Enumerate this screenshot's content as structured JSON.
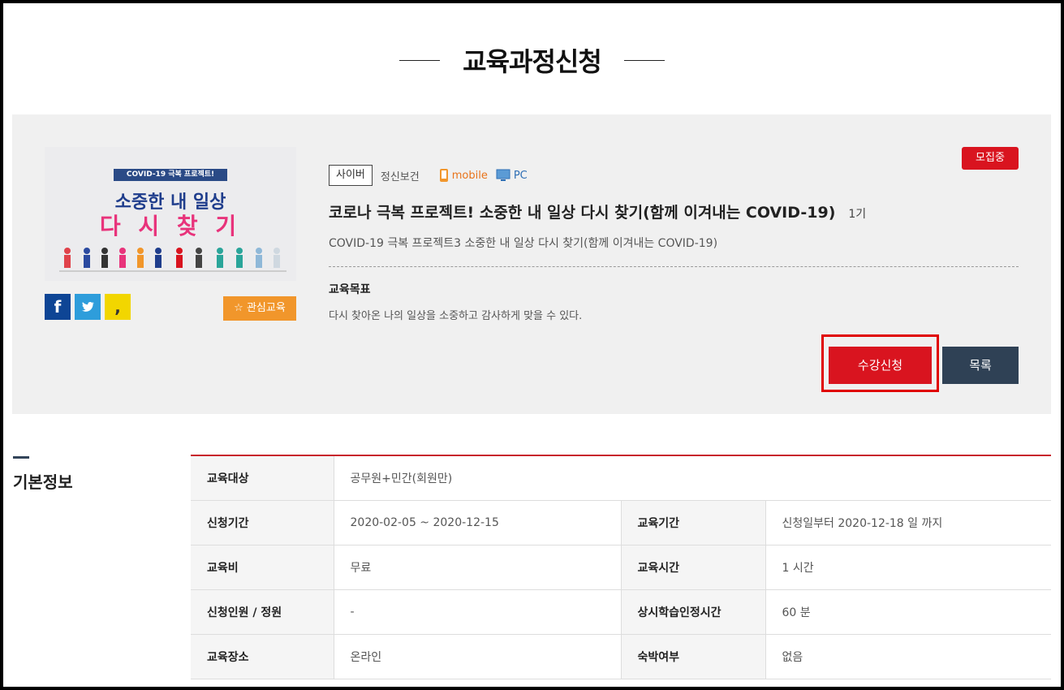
{
  "page": {
    "title": "교육과정신청"
  },
  "thumbnail": {
    "ribbon": "COVID-19 극복 프로젝트!",
    "line1": "소중한 내 일상",
    "line2": "다 시 찾 기"
  },
  "share": {
    "facebook": "f",
    "twitter": "t",
    "kakao": ","
  },
  "favorite_label": "관심교육",
  "course": {
    "status_badge": "모집중",
    "tag": "사이버",
    "category": "정신보건",
    "device_mobile": "mobile",
    "device_pc": "PC",
    "title": "코로나 극복 프로젝트! 소중한 내 일상 다시 찾기(함께 이겨내는 COVID-19)",
    "round": "1기",
    "subtitle": "COVID-19 극복 프로젝트3 소중한 내 일상 다시 찾기(함께 이겨내는 COVID-19)",
    "goal_label": "교육목표",
    "goal_text": "다시 찾아온 나의 일상을 소중하고 감사하게 맞을 수 있다."
  },
  "buttons": {
    "apply": "수강신청",
    "list": "목록"
  },
  "colors": {
    "accent_red": "#d9141f",
    "navy": "#2f4155",
    "orange": "#f1962b"
  },
  "info": {
    "section_title": "기본정보",
    "rows": [
      {
        "label": "교육대상",
        "value": "공무원+민간(회원만)"
      },
      {
        "label": "신청기간",
        "value": "2020-02-05 ~ 2020-12-15",
        "label2": "교육기간",
        "value2": "신청일부터 2020-12-18 일 까지"
      },
      {
        "label": "교육비",
        "value": "무료",
        "label2": "교육시간",
        "value2": "1 시간"
      },
      {
        "label": "신청인원 / 정원",
        "value": "-",
        "label2": "상시학습인정시간",
        "value2": "60 분"
      },
      {
        "label": "교육장소",
        "value": "온라인",
        "label2": "숙박여부",
        "value2": "없음"
      }
    ]
  }
}
